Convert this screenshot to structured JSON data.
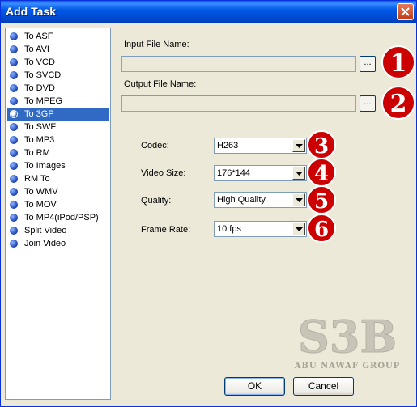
{
  "window": {
    "title": "Add Task"
  },
  "list": {
    "items": [
      {
        "label": "To ASF"
      },
      {
        "label": "To AVI"
      },
      {
        "label": "To VCD"
      },
      {
        "label": "To SVCD"
      },
      {
        "label": "To DVD"
      },
      {
        "label": "To MPEG"
      },
      {
        "label": "To 3GP",
        "selected": true
      },
      {
        "label": "To SWF"
      },
      {
        "label": "To MP3"
      },
      {
        "label": "To RM"
      },
      {
        "label": "To Images"
      },
      {
        "label": "RM To"
      },
      {
        "label": "To WMV"
      },
      {
        "label": "To MOV"
      },
      {
        "label": "To MP4(iPod/PSP)"
      },
      {
        "label": "Split Video"
      },
      {
        "label": "Join Video"
      }
    ]
  },
  "input_file": {
    "label": "Input File Name:",
    "value": "",
    "browse_label": "..."
  },
  "output_file": {
    "label": "Output File Name:",
    "value": "",
    "browse_label": "..."
  },
  "settings": {
    "codec": {
      "label": "Codec:",
      "value": "H263"
    },
    "video_size": {
      "label": "Video Size:",
      "value": "176*144"
    },
    "quality": {
      "label": "Quality:",
      "value": "High Quality"
    },
    "frame_rate": {
      "label": "Frame Rate:",
      "value": "10 fps"
    }
  },
  "markers": [
    "1",
    "2",
    "3",
    "4",
    "5",
    "6"
  ],
  "watermark": {
    "logo": "S3B",
    "caption": "ABU NAWAF GROUP"
  },
  "buttons": {
    "ok": "OK",
    "cancel": "Cancel"
  },
  "colors": {
    "title_bar": "#0058e6",
    "selection": "#316ac5",
    "marker_red": "#cc0000",
    "face": "#ece9d8"
  }
}
